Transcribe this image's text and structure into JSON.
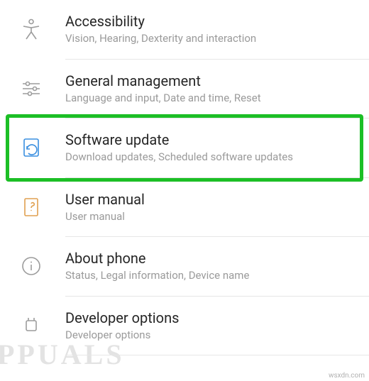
{
  "settings": {
    "items": [
      {
        "id": "accessibility",
        "title": "Accessibility",
        "subtitle": "Vision, Hearing, Dexterity and interaction",
        "icon": "accessibility-icon",
        "icon_color": "#9c9c9c"
      },
      {
        "id": "general-management",
        "title": "General management",
        "subtitle": "Language and input, Date and time, Reset",
        "icon": "sliders-icon",
        "icon_color": "#9c9c9c"
      },
      {
        "id": "software-update",
        "title": "Software update",
        "subtitle": "Download updates, Scheduled software updates",
        "icon": "update-icon",
        "icon_color": "#3a8fe0",
        "highlighted": true
      },
      {
        "id": "user-manual",
        "title": "User manual",
        "subtitle": "User manual",
        "icon": "manual-icon",
        "icon_color": "#e0a050"
      },
      {
        "id": "about-phone",
        "title": "About phone",
        "subtitle": "Status, Legal information, Device name",
        "icon": "info-icon",
        "icon_color": "#9c9c9c"
      },
      {
        "id": "developer-options",
        "title": "Developer options",
        "subtitle": "Developer options",
        "icon": "developer-icon",
        "icon_color": "#9c9c9c"
      }
    ]
  },
  "watermark_text": "PPUALS",
  "source_text": "wsxdn.com",
  "colors": {
    "highlight_border": "#1cbf26",
    "title_text": "#262626",
    "subtitle_text": "#9a9a9a",
    "divider": "#e6e6e6"
  }
}
